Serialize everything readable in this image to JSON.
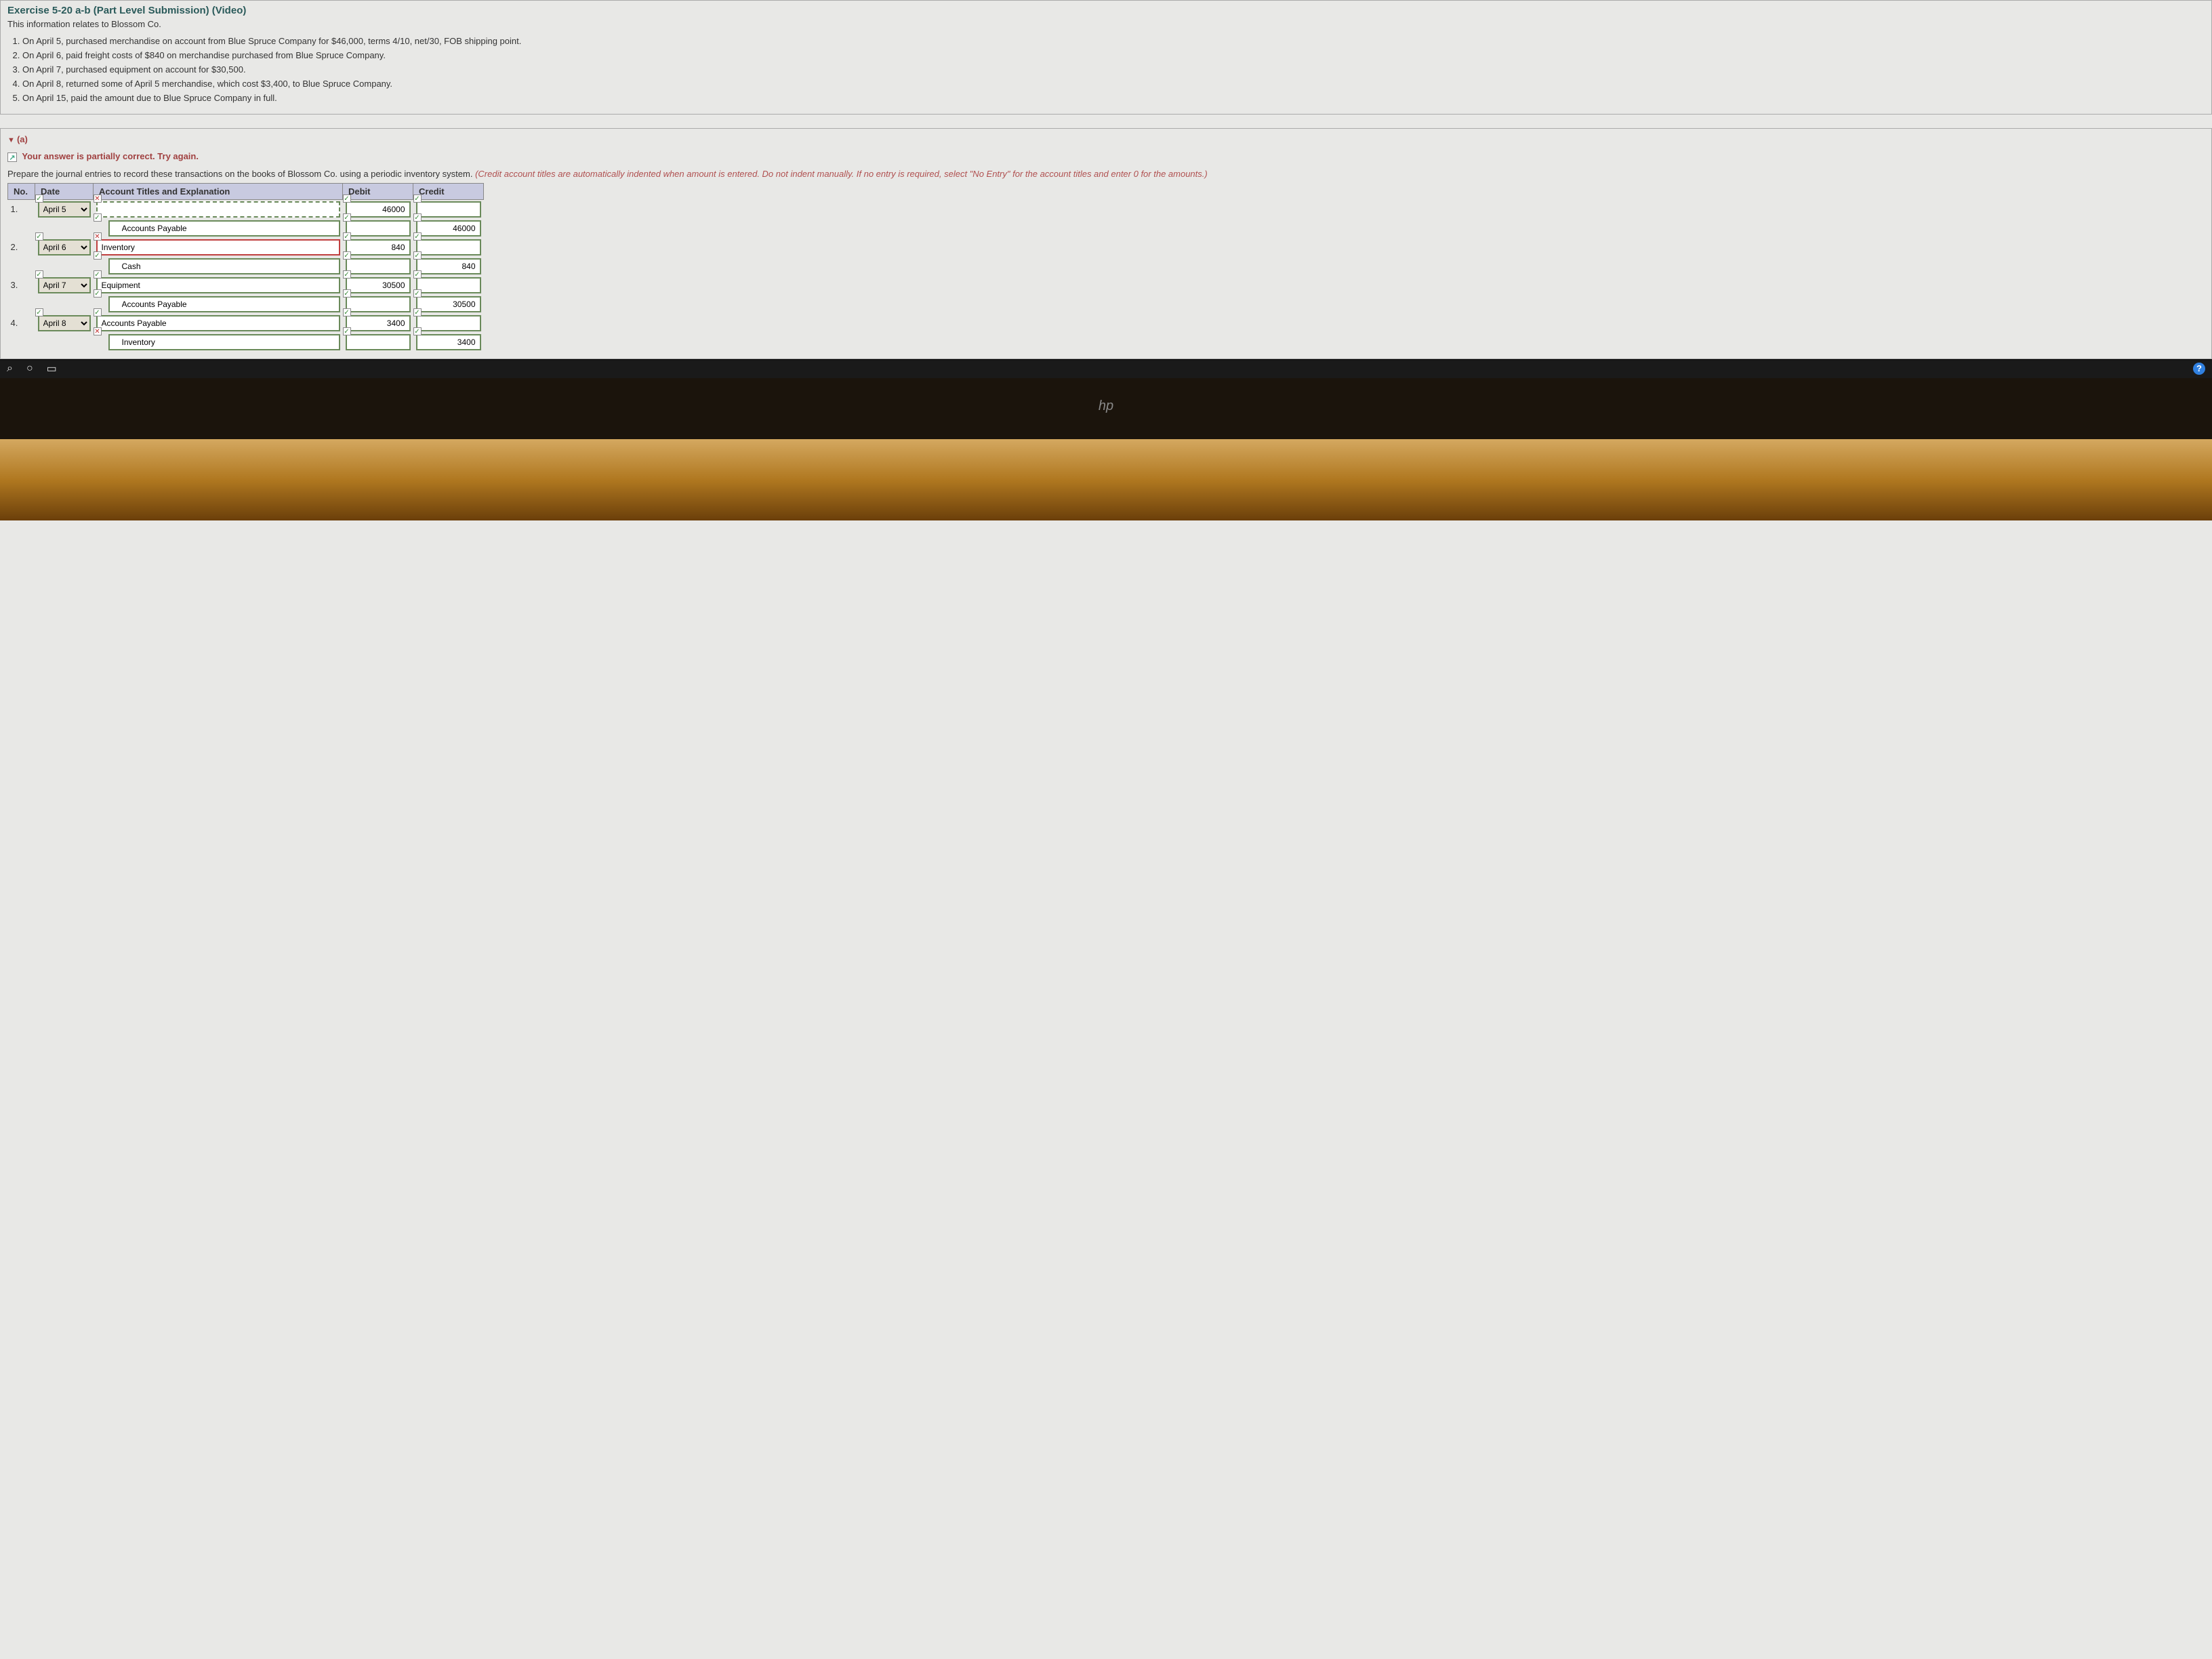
{
  "header": {
    "title": "Exercise 5-20 a-b (Part Level Submission) (Video)",
    "intro": "This information relates to Blossom Co.",
    "items": [
      "On April 5, purchased merchandise on account from Blue Spruce Company for $46,000, terms 4/10, net/30, FOB shipping point.",
      "On April 6, paid freight costs of $840 on merchandise purchased from Blue Spruce Company.",
      "On April 7, purchased equipment on account for $30,500.",
      "On April 8, returned some of April 5 merchandise, which cost $3,400, to Blue Spruce Company.",
      "On April 15, paid the amount due to Blue Spruce Company in full."
    ]
  },
  "part": {
    "label": "(a)",
    "feedback": "Your answer is partially correct.  Try again.",
    "instruction_main": "Prepare the journal entries to record these transactions on the books of Blossom Co. using a periodic inventory system. ",
    "instruction_note": "(Credit account titles are automatically indented when amount is entered. Do not indent manually. If no entry is required, select \"No Entry\" for the account titles and enter 0 for the amounts.)"
  },
  "table": {
    "headers": {
      "no": "No.",
      "date": "Date",
      "acct": "Account Titles and Explanation",
      "debit": "Debit",
      "credit": "Credit"
    }
  },
  "rows": [
    {
      "num": "1.",
      "date": "April 5",
      "date_mark": "ok",
      "acct": "",
      "acct_mark": "err",
      "acct_style": "dotted",
      "debit": "46000",
      "debit_mark": "ok",
      "credit": "",
      "credit_mark": "ok",
      "indent": false
    },
    {
      "num": "",
      "date": "",
      "date_mark": "",
      "acct": "Accounts Payable",
      "acct_mark": "ok",
      "acct_style": "",
      "debit": "",
      "debit_mark": "ok",
      "credit": "46000",
      "credit_mark": "ok",
      "indent": true
    },
    {
      "num": "2.",
      "date": "April 6",
      "date_mark": "ok",
      "acct": "Inventory",
      "acct_mark": "err",
      "acct_style": "err",
      "debit": "840",
      "debit_mark": "ok",
      "credit": "",
      "credit_mark": "ok",
      "indent": false
    },
    {
      "num": "",
      "date": "",
      "date_mark": "",
      "acct": "Cash",
      "acct_mark": "ok",
      "acct_style": "",
      "debit": "",
      "debit_mark": "ok",
      "credit": "840",
      "credit_mark": "ok",
      "indent": true
    },
    {
      "num": "3.",
      "date": "April 7",
      "date_mark": "ok",
      "acct": "Equipment",
      "acct_mark": "ok",
      "acct_style": "",
      "debit": "30500",
      "debit_mark": "ok",
      "credit": "",
      "credit_mark": "ok",
      "indent": false
    },
    {
      "num": "",
      "date": "",
      "date_mark": "",
      "acct": "Accounts Payable",
      "acct_mark": "ok",
      "acct_style": "",
      "debit": "",
      "debit_mark": "ok",
      "credit": "30500",
      "credit_mark": "ok",
      "indent": true
    },
    {
      "num": "4.",
      "date": "April 8",
      "date_mark": "ok",
      "acct": "Accounts Payable",
      "acct_mark": "ok",
      "acct_style": "",
      "debit": "3400",
      "debit_mark": "ok",
      "credit": "",
      "credit_mark": "ok",
      "indent": false
    },
    {
      "num": "",
      "date": "",
      "date_mark": "",
      "acct": "Inventory",
      "acct_mark": "err",
      "acct_style": "",
      "debit": "",
      "debit_mark": "ok",
      "credit": "3400",
      "credit_mark": "ok",
      "indent": true
    }
  ],
  "marks": {
    "ok": "✓",
    "err": "✕"
  },
  "taskbar": {
    "search_icon": "⌕",
    "cortana_icon": "○",
    "taskview_icon": "▭",
    "help": "?"
  },
  "logo": "hp"
}
